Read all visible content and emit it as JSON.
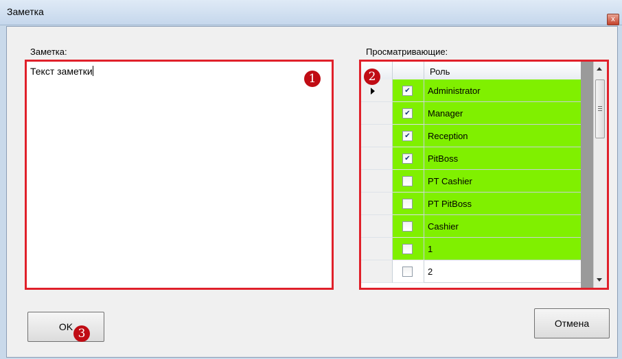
{
  "window": {
    "title": "Заметка",
    "close_glyph": "x"
  },
  "note": {
    "label": "Заметка:",
    "text": "Текст заметки"
  },
  "viewers": {
    "label": "Просматривающие:",
    "column_role": "Роль",
    "rows": [
      {
        "role": "Administrator",
        "checked": true,
        "current": true,
        "highlight": true
      },
      {
        "role": "Manager",
        "checked": true,
        "highlight": true
      },
      {
        "role": "Reception",
        "checked": true,
        "highlight": true
      },
      {
        "role": "PitBoss",
        "checked": true,
        "highlight": true
      },
      {
        "role": "PT Cashier",
        "checked": false,
        "highlight": true
      },
      {
        "role": "PT PitBoss",
        "checked": false,
        "highlight": true
      },
      {
        "role": "Cashier",
        "checked": false,
        "highlight": true
      },
      {
        "role": "1",
        "checked": false,
        "highlight": true
      },
      {
        "role": "2",
        "checked": false,
        "highlight": false
      }
    ]
  },
  "buttons": {
    "ok": "OK",
    "cancel": "Отмена"
  },
  "annotations": {
    "b1": "1",
    "b2": "2",
    "b3": "3"
  },
  "colors": {
    "highlight": "#80f000",
    "annotation_border": "#e0202a",
    "badge": "#c00c14"
  }
}
